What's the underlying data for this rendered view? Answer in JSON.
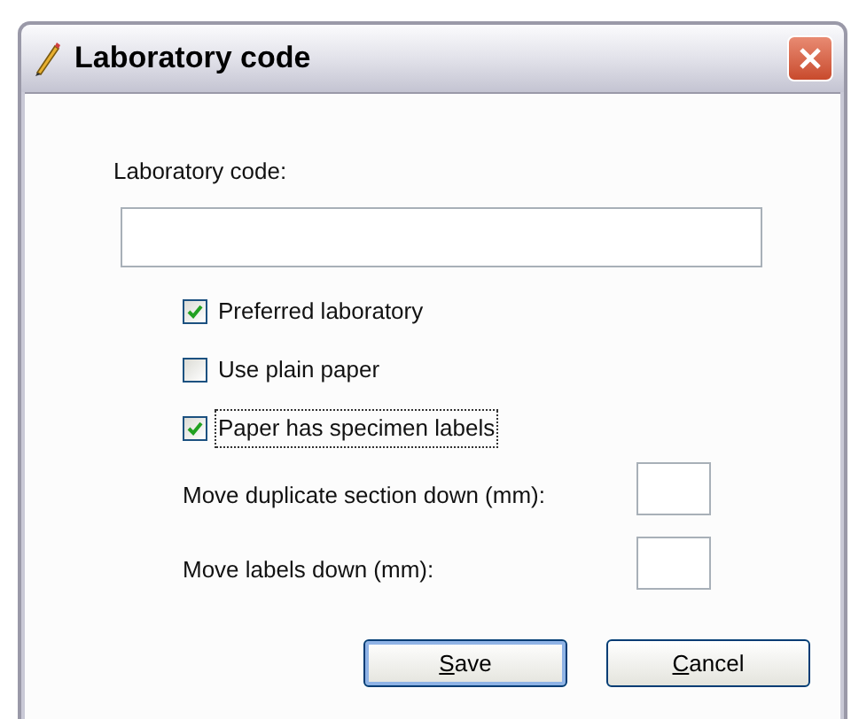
{
  "window": {
    "title": "Laboratory code"
  },
  "code_field": {
    "label": "Laboratory code:"
  },
  "checkboxes": [
    {
      "label": "Preferred laboratory",
      "checked": true,
      "focused": false
    },
    {
      "label": "Use plain paper",
      "checked": false,
      "focused": false
    },
    {
      "label": "Paper has specimen labels",
      "checked": true,
      "focused": true
    }
  ],
  "number_fields": [
    {
      "label": "Move duplicate section down (mm):"
    },
    {
      "label": "Move labels down (mm):"
    }
  ],
  "buttons": [
    {
      "label": "Save",
      "default": true
    },
    {
      "label": "Cancel",
      "default": false
    }
  ]
}
